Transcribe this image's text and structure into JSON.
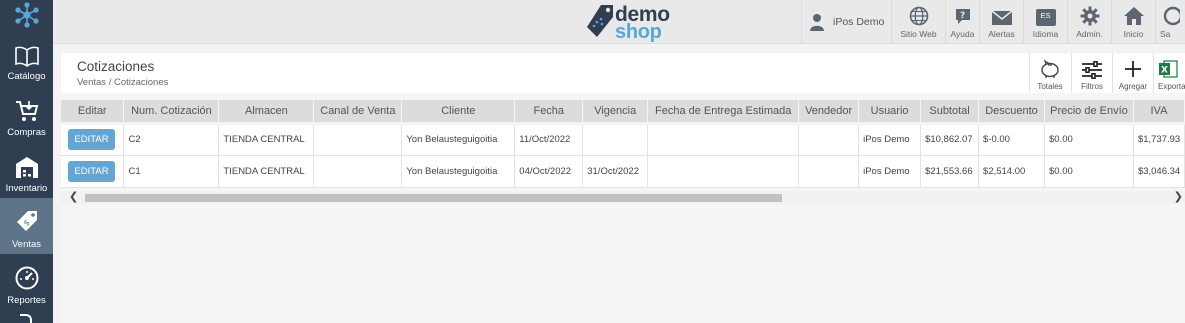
{
  "sidebar": {
    "items": [
      {
        "label": "Catálogo",
        "icon": "book-icon"
      },
      {
        "label": "Compras",
        "icon": "cart-icon"
      },
      {
        "label": "Inventario",
        "icon": "warehouse-icon"
      },
      {
        "label": "Ventas",
        "icon": "tag-icon"
      },
      {
        "label": "Reportes",
        "icon": "gauge-icon"
      }
    ]
  },
  "header": {
    "brand_word1": "demo",
    "brand_word2": "shop",
    "user_name": "iPos Demo",
    "nav": [
      {
        "label": "Sitio Web",
        "icon": "globe-icon"
      },
      {
        "label": "Ayuda",
        "icon": "help-icon"
      },
      {
        "label": "Alertas",
        "icon": "mail-icon"
      },
      {
        "label": "Idioma",
        "icon": "language-icon",
        "badge": "ES"
      },
      {
        "label": "Admin.",
        "icon": "gear-icon"
      },
      {
        "label": "Inicio",
        "icon": "home-icon"
      },
      {
        "label": "Sa",
        "icon": "exit-icon"
      }
    ]
  },
  "page": {
    "title": "Cotizaciones",
    "breadcrumb": "Ventas / Cotizaciones"
  },
  "toolbar": {
    "totales": "Totales",
    "filtros": "Filtros",
    "agregar": "Agregar",
    "exportar": "Exporta"
  },
  "table": {
    "columns": [
      "Editar",
      "Num. Cotización",
      "Almacen",
      "Canal de Venta",
      "Cliente",
      "Fecha",
      "Vigencia",
      "Fecha de Entrega Estimada",
      "Vendedor",
      "Usuario",
      "Subtotal",
      "Descuento",
      "Precio de Envío",
      "IVA"
    ],
    "edit_label": "EDITAR",
    "rows": [
      {
        "num": "C2",
        "almacen": "TIENDA CENTRAL",
        "canal": "",
        "cliente": "Yon Belausteguigoitia",
        "fecha": "11/Oct/2022",
        "vigencia": "",
        "entrega": "",
        "vendedor": "",
        "usuario": "iPos Demo",
        "subtotal": "$10,862.07",
        "descuento": "$-0.00",
        "envio": "$0.00",
        "iva": "$1,737.93"
      },
      {
        "num": "C1",
        "almacen": "TIENDA CENTRAL",
        "canal": "",
        "cliente": "Yon Belausteguigoitia",
        "fecha": "04/Oct/2022",
        "vigencia": "31/Oct/2022",
        "entrega": "",
        "vendedor": "",
        "usuario": "iPos Demo",
        "subtotal": "$21,553.66",
        "descuento": "$2,514.00",
        "envio": "$0.00",
        "iva": "$3,046.34"
      }
    ]
  },
  "scrollbar": {
    "left_arrow": "❮",
    "right_arrow": "❯"
  }
}
